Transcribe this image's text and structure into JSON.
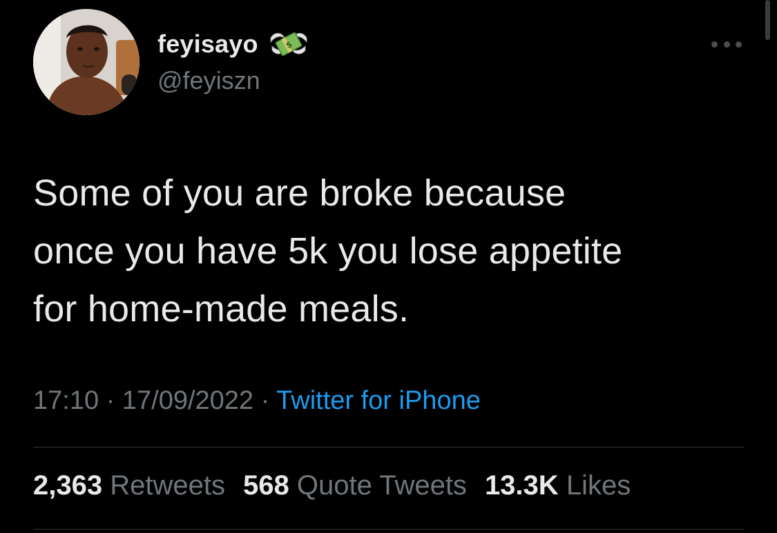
{
  "user": {
    "display_name": "feyisayo",
    "handle": "@feyiszn",
    "name_emoji": "money-with-wings-icon"
  },
  "tweet": {
    "text": "Some of you are broke because\nonce you have 5k you lose appetite\nfor home-made meals."
  },
  "meta": {
    "time": "17:10",
    "separator": "·",
    "date": "17/09/2022",
    "source": "Twitter for iPhone"
  },
  "stats": {
    "retweets_count": "2,363",
    "retweets_label": "Retweets",
    "quotes_count": "568",
    "quotes_label": "Quote Tweets",
    "likes_count": "13.3K",
    "likes_label": "Likes"
  },
  "colors": {
    "background": "#000000",
    "text": "#e7e9ea",
    "secondary": "#71767b",
    "accent": "#1d9bf0",
    "divider": "#2f3336"
  }
}
